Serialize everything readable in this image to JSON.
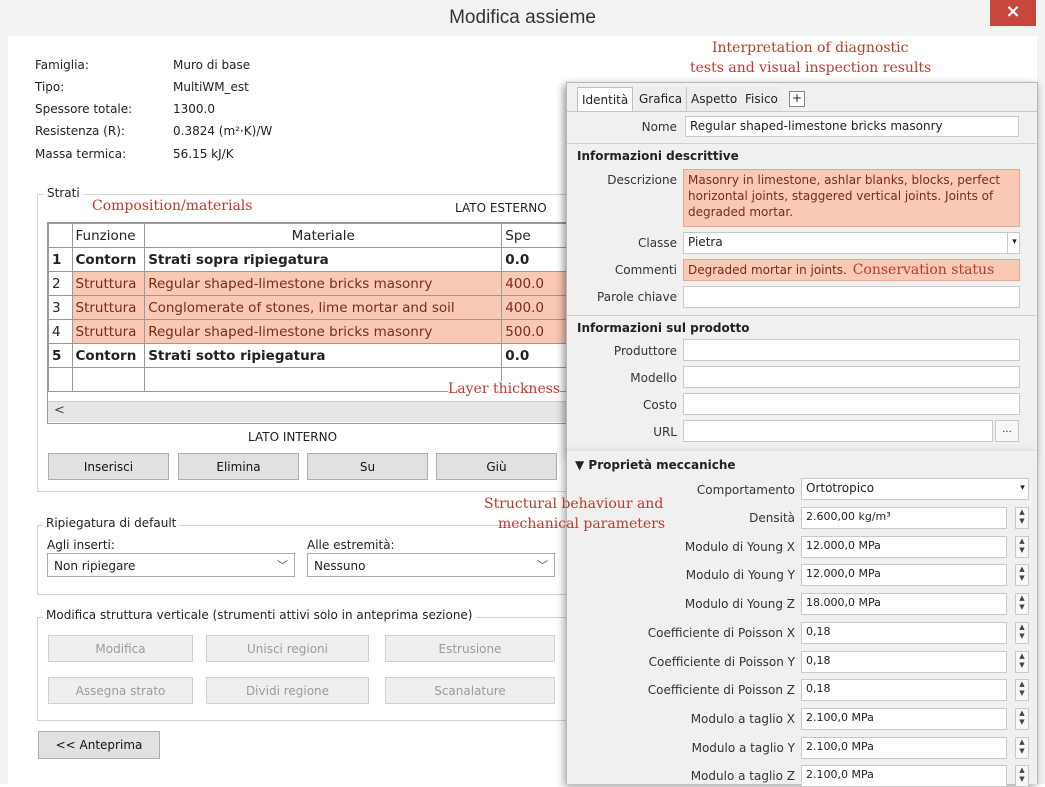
{
  "window": {
    "title": "Modifica assieme",
    "close_label": "×"
  },
  "info": [
    {
      "label": "Famiglia:",
      "value": "Muro di base"
    },
    {
      "label": "Tipo:",
      "value": "MultiWM_est"
    },
    {
      "label": "Spessore totale:",
      "value": "1300.0"
    },
    {
      "label": "Resistenza (R):",
      "value": "0.3824 (m²·K)/W"
    },
    {
      "label": "Massa termica:",
      "value": "56.15 kJ/K"
    }
  ],
  "strati": {
    "legend": "Strati",
    "outer_label": "LATO ESTERNO",
    "inner_label": "LATO INTERNO",
    "columns": [
      "Funzione",
      "Materiale",
      "Spe"
    ],
    "rows": [
      {
        "n": "1",
        "funzione": "Contorn",
        "materiale": "Strati sopra ripiegatura",
        "spessore": "0.0"
      },
      {
        "n": "2",
        "funzione": "Struttura",
        "materiale": "Regular shaped-limestone bricks masonry",
        "spessore": "400.0"
      },
      {
        "n": "3",
        "funzione": "Struttura",
        "materiale": "Conglomerate of stones, lime mortar and soil",
        "spessore": "400.0"
      },
      {
        "n": "4",
        "funzione": "Struttura",
        "materiale": "Regular shaped-limestone bricks masonry",
        "spessore": "500.0"
      },
      {
        "n": "5",
        "funzione": "Contorn",
        "materiale": "Strati sotto ripiegatura",
        "spessore": "0.0"
      }
    ],
    "scroll_left": "<",
    "buttons": [
      "Inserisci",
      "Elimina",
      "Su",
      "Giù"
    ]
  },
  "ripiegatura": {
    "legend": "Ripiegatura di default",
    "inserti_label": "Agli inserti:",
    "inserti_value": "Non ripiegare",
    "estremita_label": "Alle estremità:",
    "estremita_value": "Nessuno"
  },
  "struttura_verticale": {
    "legend": "Modifica struttura verticale (strumenti attivi solo in anteprima sezione)",
    "buttons": [
      "Modifica",
      "Unisci regioni",
      "Estrusione",
      "Assegna strato",
      "Dividi regione",
      "Scanalature"
    ]
  },
  "preview_button": "<< Anteprima",
  "annotations": {
    "interpretation_line1": "Interpretation of diagnostic",
    "interpretation_line2": "tests and visual inspection results",
    "composition": "Composition/materials",
    "layer_thickness": "Layer thickness",
    "structural_line1": "Structural behaviour and",
    "structural_line2": "mechanical parameters",
    "conservation": "Conservation status"
  },
  "material_panel": {
    "tabs": [
      "Identità",
      "Grafica",
      "Aspetto",
      "Fisico",
      "+"
    ],
    "nome_label": "Nome",
    "nome_value": "Regular shaped-limestone bricks masonry",
    "descr_section": "Informazioni descrittive",
    "descrizione_label": "Descrizione",
    "descrizione_value": "Masonry in limestone, ashlar blanks, blocks, perfect horizontal joints, staggered vertical joints. Joints of degraded mortar.",
    "classe_label": "Classe",
    "classe_value": "Pietra",
    "commenti_label": "Commenti",
    "commenti_value": "Degraded mortar in joints.",
    "parole_label": "Parole chiave",
    "parole_value": "",
    "prod_section": "Informazioni sul prodotto",
    "produttore_label": "Produttore",
    "modello_label": "Modello",
    "costo_label": "Costo",
    "url_label": "URL",
    "browse_label": "..."
  },
  "mechanical": {
    "section": "▼ Proprietà meccaniche",
    "comportamento_label": "Comportamento",
    "comportamento_value": "Ortotropico",
    "props": [
      {
        "label": "Densità",
        "value": "2.600,00 kg/m³"
      },
      {
        "label": "Modulo di Young X",
        "value": "12.000,0 MPa"
      },
      {
        "label": "Modulo di Young Y",
        "value": "12.000,0 MPa"
      },
      {
        "label": "Modulo di Young Z",
        "value": "18.000,0 MPa"
      },
      {
        "label": "Coefficiente di Poisson X",
        "value": "0,18"
      },
      {
        "label": "Coefficiente di Poisson Y",
        "value": "0,18"
      },
      {
        "label": "Coefficiente di Poisson Z",
        "value": "0,18"
      },
      {
        "label": "Modulo a taglio X",
        "value": "2.100,0 MPa"
      },
      {
        "label": "Modulo a taglio Y",
        "value": "2.100,0 MPa"
      },
      {
        "label": "Modulo a taglio Z",
        "value": "2.100,0 MPa"
      }
    ]
  }
}
